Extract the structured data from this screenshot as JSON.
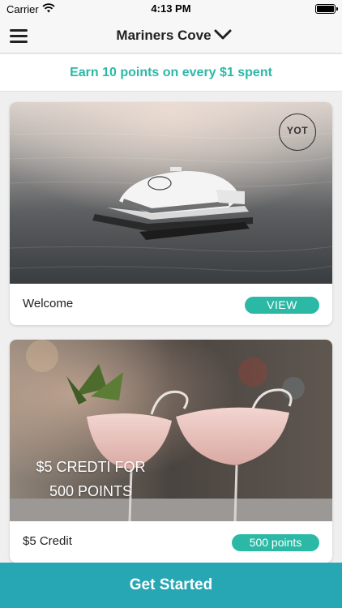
{
  "status_bar": {
    "carrier": "Carrier",
    "time": "4:13 PM"
  },
  "nav": {
    "title": "Mariners Cove"
  },
  "promo": {
    "text": "Earn 10 points on every $1 spent"
  },
  "cards": [
    {
      "label": "Welcome",
      "action_label": "VIEW",
      "logo_text": "YOT",
      "image": "boat-on-water-photo"
    },
    {
      "label": "$5 Credit",
      "badge_label": "500 points",
      "overlay_line1": "$5 CREDTI FOR",
      "overlay_line2": "500 POINTS",
      "image": "pink-cocktails-photo"
    }
  ],
  "cta": {
    "label": "Get Started"
  },
  "colors": {
    "accent": "#2bb9a6",
    "cta_background": "#27a7b3"
  },
  "icons": {
    "menu": "hamburger-menu-icon",
    "dropdown": "chevron-down-icon"
  }
}
